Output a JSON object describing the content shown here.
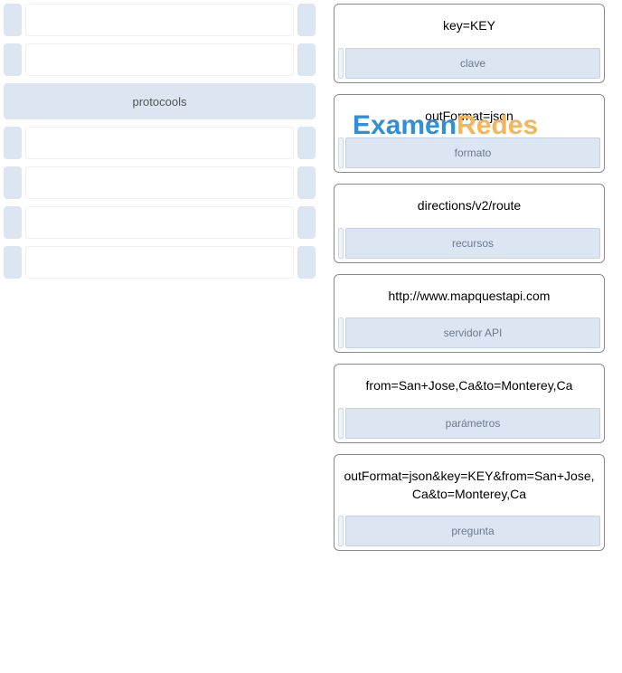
{
  "watermark": {
    "part1": "Examen ",
    "part2": "Redes"
  },
  "left": {
    "label_visible": "protocools"
  },
  "cards": [
    {
      "value": "key=KEY",
      "label": "clave"
    },
    {
      "value": "outFormat=json",
      "label": "formato"
    },
    {
      "value": "directions/v2/route",
      "label": "recursos"
    },
    {
      "value": "http://www.mapquestapi.com",
      "label": "servidor API"
    },
    {
      "value": "from=San+Jose,Ca&to=Monterey,Ca",
      "label": "parámetros"
    },
    {
      "value": "outFormat=json&key=KEY&from=San+Jose,Ca&to=Monterey,Ca",
      "label": "pregunta"
    }
  ]
}
